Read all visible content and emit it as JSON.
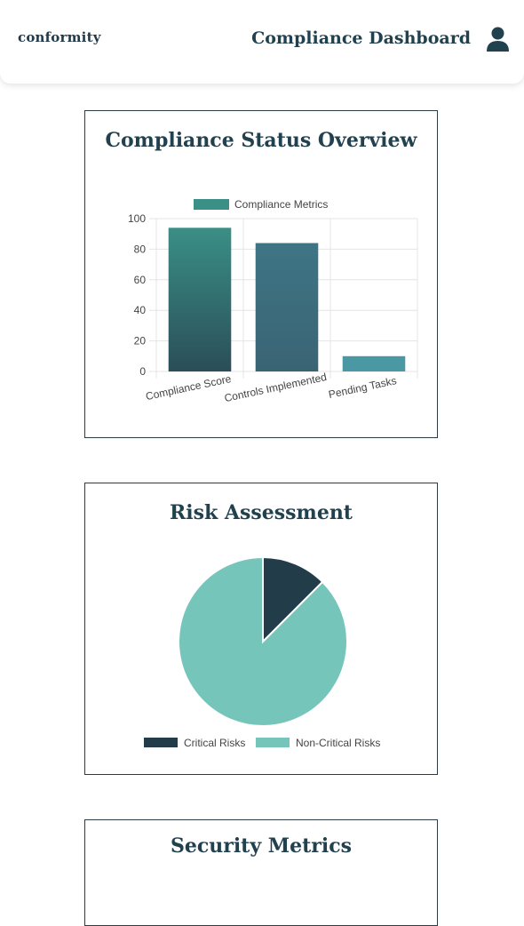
{
  "header": {
    "logo": "conformity",
    "title": "Compliance Dashboard"
  },
  "icons": {
    "user": "user-icon"
  },
  "compliance_card": {
    "title": "Compliance Status Overview"
  },
  "risk_card": {
    "title": "Risk Assessment"
  },
  "security_card": {
    "title": "Security Metrics"
  },
  "colors": {
    "primary_dark": "#21414f",
    "bar_top": "#3a8f86",
    "bar_bottom": "#2a4e58",
    "bar_mid": "#3e7585",
    "bar_light": "#4a98a3",
    "teal_light": "#76c5bb",
    "navy": "#233c4a"
  },
  "chart_data": [
    {
      "type": "bar",
      "categories": [
        "Compliance Score",
        "Controls Implemented",
        "Pending Tasks"
      ],
      "series": [
        {
          "name": "Compliance Metrics",
          "values": [
            94,
            84,
            10
          ]
        }
      ],
      "ylim": [
        0,
        100
      ],
      "yticks": [
        0,
        20,
        40,
        60,
        80,
        100
      ],
      "grid": true,
      "legend": "top"
    },
    {
      "type": "pie",
      "labels": [
        "Critical Risks",
        "Non-Critical Risks"
      ],
      "values": [
        12.5,
        87.5
      ],
      "colors": [
        "#233c4a",
        "#76c5bb"
      ],
      "legend": "bottom"
    }
  ]
}
